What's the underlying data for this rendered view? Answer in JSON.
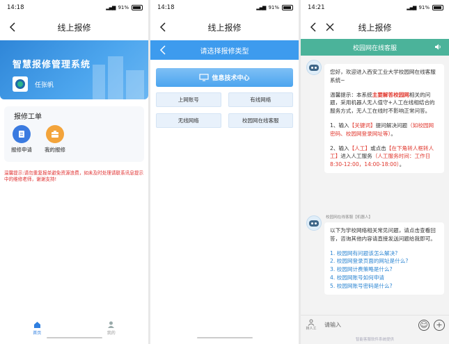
{
  "screen1": {
    "status": {
      "time": "14:18",
      "battery": "91%"
    },
    "nav_title": "线上报修",
    "banner_title": "智慧报修管理系统",
    "user_name": "任张帆",
    "card_title": "报修工单",
    "actions": [
      {
        "label": "报修申请",
        "icon": "form-icon"
      },
      {
        "label": "我的报修",
        "icon": "toolbox-icon"
      }
    ],
    "warning": "温馨提示:请勿重复报单避免资源浪费，如未及时处理请联系讯息提示中的维修老师，谢谢支持!",
    "tabs": [
      {
        "label": "首页"
      },
      {
        "label": "我的"
      }
    ]
  },
  "screen2": {
    "status": {
      "time": "14:18",
      "battery": "91%"
    },
    "nav_title": "线上报修",
    "sub_title": "请选择报修类型",
    "category": "信息技术中心",
    "options": [
      "上网账号",
      "有线网络",
      "无线网络",
      "校园网在线客服"
    ]
  },
  "screen3": {
    "status": {
      "time": "14:21",
      "battery": "91%"
    },
    "nav_title": "线上报修",
    "chat_title": "校园网在线客服",
    "msg1": {
      "p1": "您好，欢迎进入西安工业大学校园网在线客服系统~",
      "p2_a": "温馨提示：本系统",
      "p2_b": "主要解答校园网",
      "p2_c": "相关的问题，采用机器人无人值守+人工在线相结合的服务方式，无人工在线时不影响正常问答。",
      "p3_a": "1、输入",
      "p3_b": "【关键词】",
      "p3_c": "提问解决问题",
      "p3_d": "（如校园网密码、校园网登录网址等）",
      "p3_e": "。",
      "p4_a": "2、输入",
      "p4_b": "【人工】",
      "p4_c": "或点击",
      "p4_d": "【在下角转人框转人工】",
      "p4_e": "进入人工服务",
      "p4_f": "（人工服务时间：工作日8:30-12:00，14:00-18:00）",
      "p4_g": "。"
    },
    "bot_name": "校园网在线客服【机器人】",
    "msg2": {
      "intro": "以下为学校网络相关常见问题，请点击查看回答，咨询其他内容请直接发送问题给我即可。",
      "questions": [
        "1. 校园网有问题该怎么解决?",
        "2. 校园网登录页面的网址是什么?",
        "3. 校园网计费策略是什么?",
        "4. 校园网账号如何申请",
        "5. 校园网账号密码是什么?"
      ]
    },
    "person_label": "转人工",
    "input_placeholder": "请输入",
    "footer": "智能客服软件系统提供"
  }
}
